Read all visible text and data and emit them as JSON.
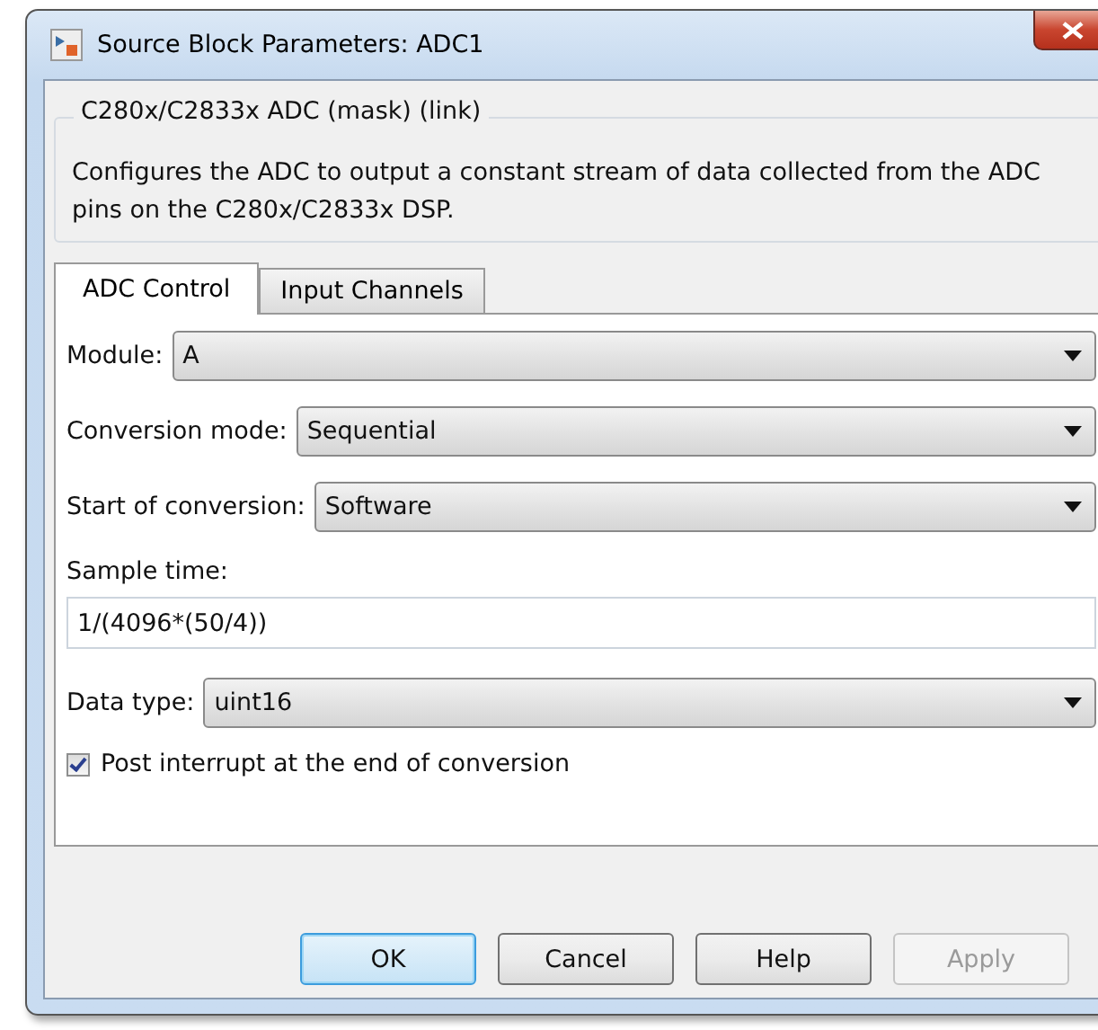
{
  "window": {
    "title": "Source Block Parameters: ADC1"
  },
  "group": {
    "title": "C280x/C2833x ADC (mask) (link)",
    "description": "Configures the ADC to output a constant stream of data collected from the ADC pins on the C280x/C2833x DSP."
  },
  "tabs": [
    {
      "label": "ADC Control",
      "selected": true
    },
    {
      "label": "Input Channels",
      "selected": false
    }
  ],
  "fields": [
    {
      "kind": "dropdown",
      "label": "Module:",
      "value": "A"
    },
    {
      "kind": "dropdown",
      "label": "Conversion mode:",
      "value": "Sequential"
    },
    {
      "kind": "dropdown",
      "label": "Start of conversion:",
      "value": "Software"
    },
    {
      "kind": "text",
      "label": "Sample time:",
      "value": "1/(4096*(50/4))"
    },
    {
      "kind": "dropdown",
      "label": "Data type:",
      "value": "uint16"
    },
    {
      "kind": "checkbox",
      "label": "Post interrupt at the end of conversion",
      "checked": true
    }
  ],
  "buttons": [
    {
      "label": "OK",
      "default": true,
      "disabled": false
    },
    {
      "label": "Cancel",
      "default": false,
      "disabled": false
    },
    {
      "label": "Help",
      "default": false,
      "disabled": false
    },
    {
      "label": "Apply",
      "default": false,
      "disabled": true
    }
  ]
}
